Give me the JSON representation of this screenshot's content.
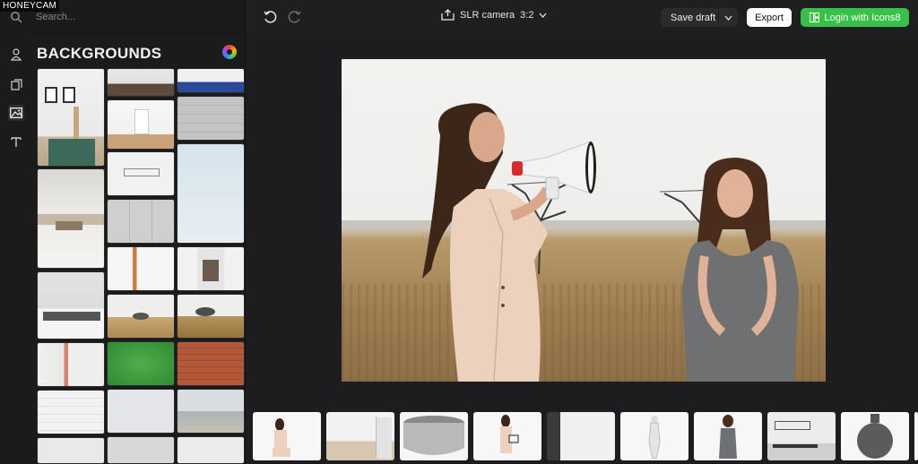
{
  "watermark": "HONEYCAM",
  "search": {
    "placeholder": "Search..."
  },
  "panel": {
    "title": "BACKGROUNDS"
  },
  "rail": {
    "items": [
      {
        "icon": "person-icon"
      },
      {
        "icon": "layers-icon"
      },
      {
        "icon": "image-icon",
        "active": true
      },
      {
        "icon": "text-icon"
      }
    ]
  },
  "topbar": {
    "camera_label": "SLR camera",
    "ratio": "3:2",
    "save_draft": "Save draft",
    "export": "Export",
    "login": "Login with Icons8"
  },
  "colors": {
    "accent_green": "#37c149",
    "bg": "#1d1d1f",
    "panel": "#1b1b1c"
  }
}
